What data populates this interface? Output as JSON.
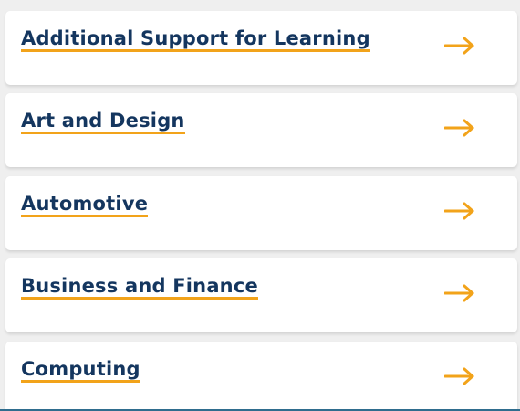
{
  "colors": {
    "background": "#efefef",
    "card": "#ffffff",
    "title_text": "#14365f",
    "accent": "#f2a31a"
  },
  "categories": [
    {
      "label": "Additional Support for Learning",
      "icon": "arrow-right-icon"
    },
    {
      "label": "Art and Design",
      "icon": "arrow-right-icon"
    },
    {
      "label": "Automotive",
      "icon": "arrow-right-icon"
    },
    {
      "label": "Business and Finance",
      "icon": "arrow-right-icon"
    },
    {
      "label": "Computing",
      "icon": "arrow-right-icon"
    }
  ]
}
